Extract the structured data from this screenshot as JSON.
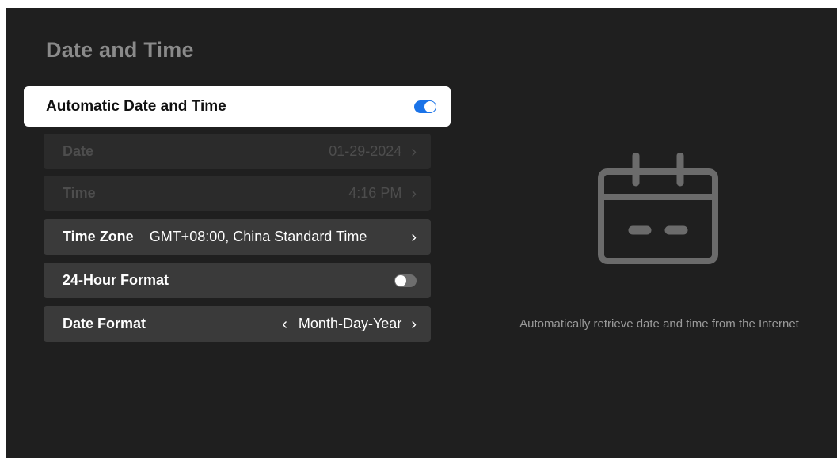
{
  "page": {
    "title": "Date and Time"
  },
  "settings": {
    "automatic": {
      "label": "Automatic Date and Time",
      "enabled": true
    },
    "date": {
      "label": "Date",
      "value": "01-29-2024",
      "disabled": true
    },
    "time": {
      "label": "Time",
      "value": "4:16 PM",
      "disabled": true
    },
    "time_zone": {
      "label": "Time Zone",
      "value": "GMT+08:00, China Standard Time"
    },
    "hour_format": {
      "label": "24-Hour Format",
      "enabled": false
    },
    "date_format": {
      "label": "Date Format",
      "value": "Month-Day-Year"
    }
  },
  "glyphs": {
    "chevron_right": "›",
    "chevron_left": "‹"
  },
  "detail": {
    "icon": "calendar-icon",
    "description": "Automatically retrieve date and time from the Internet"
  },
  "colors": {
    "background": "#1f1f1f",
    "accent": "#1a73e8",
    "row": "#3a3a3a",
    "focused_row": "#ffffff"
  }
}
